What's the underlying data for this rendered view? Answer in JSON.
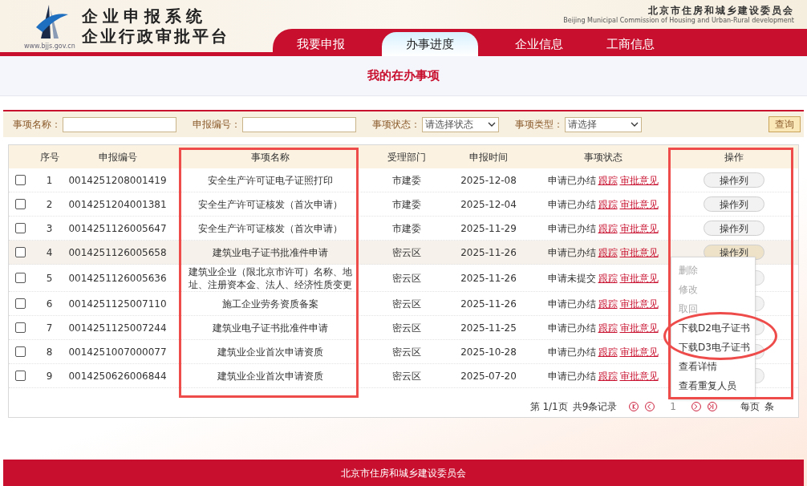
{
  "header": {
    "title": "企业申报系统",
    "subtitle": "企业行政审批平台",
    "logo_caption": "www.bjjs.gov.cn",
    "org_name": "北京市住房和城乡建设委员会",
    "org_name_en": "Beijing Municipal Commission of Housing and Urban-Rural development"
  },
  "tabs": [
    {
      "label": "我要申报",
      "selected": false
    },
    {
      "label": "办事进度",
      "selected": true
    },
    {
      "label": "企业信息",
      "selected": false
    },
    {
      "label": "工商信息",
      "selected": false
    }
  ],
  "page_title": "我的在办事项",
  "filters": [
    {
      "label": "事项名称：",
      "kind": "text"
    },
    {
      "label": "申报编号：",
      "kind": "text"
    },
    {
      "label": "事项状态：",
      "kind": "select",
      "value": "请选择状态"
    },
    {
      "label": "事项类型：",
      "kind": "select",
      "value": "请选择"
    }
  ],
  "search_button": "查询",
  "table": {
    "columns": [
      {
        "label": "序号"
      },
      {
        "label": "申报编号"
      },
      {
        "label": "事项名称"
      },
      {
        "label": "受理部门"
      },
      {
        "label": "申报时间"
      },
      {
        "label": "事项状态"
      },
      {
        "label": "操作"
      }
    ],
    "rows": [
      {
        "checked": false,
        "hovered": false,
        "no": "1",
        "code": "0014251208001419",
        "name": "安全生产许可证电子证照打印",
        "dept": "市建委",
        "date": "2025-12-08",
        "status": "申请已办结",
        "links": [
          "跟踪",
          "审批意见"
        ],
        "action": "操作列"
      },
      {
        "checked": false,
        "hovered": false,
        "no": "2",
        "code": "0014251204001381",
        "name": "安全生产许可证核发（首次申请）",
        "dept": "市建委",
        "date": "2025-12-04",
        "status": "申请已办结",
        "links": [
          "跟踪",
          "审批意见"
        ],
        "action": "操作列"
      },
      {
        "checked": false,
        "hovered": false,
        "no": "3",
        "code": "0014251126005647",
        "name": "安全生产许可证核发（首次申请）",
        "dept": "市建委",
        "date": "2025-11-29",
        "status": "申请已办结",
        "links": [
          "跟踪",
          "审批意见"
        ],
        "action": "操作列"
      },
      {
        "checked": false,
        "hovered": true,
        "no": "4",
        "code": "0014251126005658",
        "name": "建筑业电子证书批准件申请",
        "dept": "密云区",
        "date": "2025-11-26",
        "status": "申请已办结",
        "links": [
          "跟踪",
          "审批意见"
        ],
        "action": "操作列"
      },
      {
        "checked": false,
        "hovered": false,
        "no": "5",
        "code": "0014251126005636",
        "name": "建筑业企业（限北京市许可）名称、地址、注册资本金、法人、经济性质变更",
        "dept": "密云区",
        "date": "2025-11-26",
        "status": "申请未提交",
        "links": [
          "跟踪",
          "审批意见"
        ]
      },
      {
        "checked": false,
        "hovered": false,
        "no": "6",
        "code": "0014251125007110",
        "name": "施工企业劳务资质备案",
        "dept": "密云区",
        "date": "2025-11-26",
        "status": "申请已办结",
        "links": [
          "跟踪",
          "审批意见"
        ]
      },
      {
        "checked": false,
        "hovered": false,
        "no": "7",
        "code": "0014251125007244",
        "name": "建筑业电子证书批准件申请",
        "dept": "密云区",
        "date": "2025-11-25",
        "status": "申请已办结",
        "links": [
          "跟踪",
          "审批意见"
        ]
      },
      {
        "checked": false,
        "hovered": false,
        "no": "8",
        "code": "0014251007000077",
        "name": "建筑业企业首次申请资质",
        "dept": "密云区",
        "date": "2025-10-28",
        "status": "申请已办结",
        "links": [
          "跟踪",
          "审批意见"
        ]
      },
      {
        "checked": false,
        "hovered": false,
        "no": "9",
        "code": "0014250626006844",
        "name": "建筑业企业首次申请资质",
        "dept": "密云区",
        "date": "2025-07-20",
        "status": "申请已办结",
        "links": [
          "跟踪",
          "审批意见"
        ]
      }
    ]
  },
  "action_menu": [
    {
      "label": "删除",
      "disabled": true
    },
    {
      "label": "修改",
      "disabled": true
    },
    {
      "label": "取回",
      "disabled": true
    },
    {
      "label": "下载D2电子证书",
      "disabled": false
    },
    {
      "label": "下载D3电子证书",
      "disabled": false
    },
    {
      "label": "查看详情",
      "disabled": false
    },
    {
      "label": "查看重复人员",
      "disabled": false
    }
  ],
  "annotations": [
    {
      "kind": "frame"
    },
    {
      "kind": "frame"
    },
    {
      "kind": "ellipse"
    }
  ],
  "pager": {
    "page": "第 1/1页",
    "total": "共9条记录",
    "current": "1",
    "per_page": "每页",
    "per_page_unit": "条"
  },
  "footer": "北京市住房和城乡建设委员会"
}
